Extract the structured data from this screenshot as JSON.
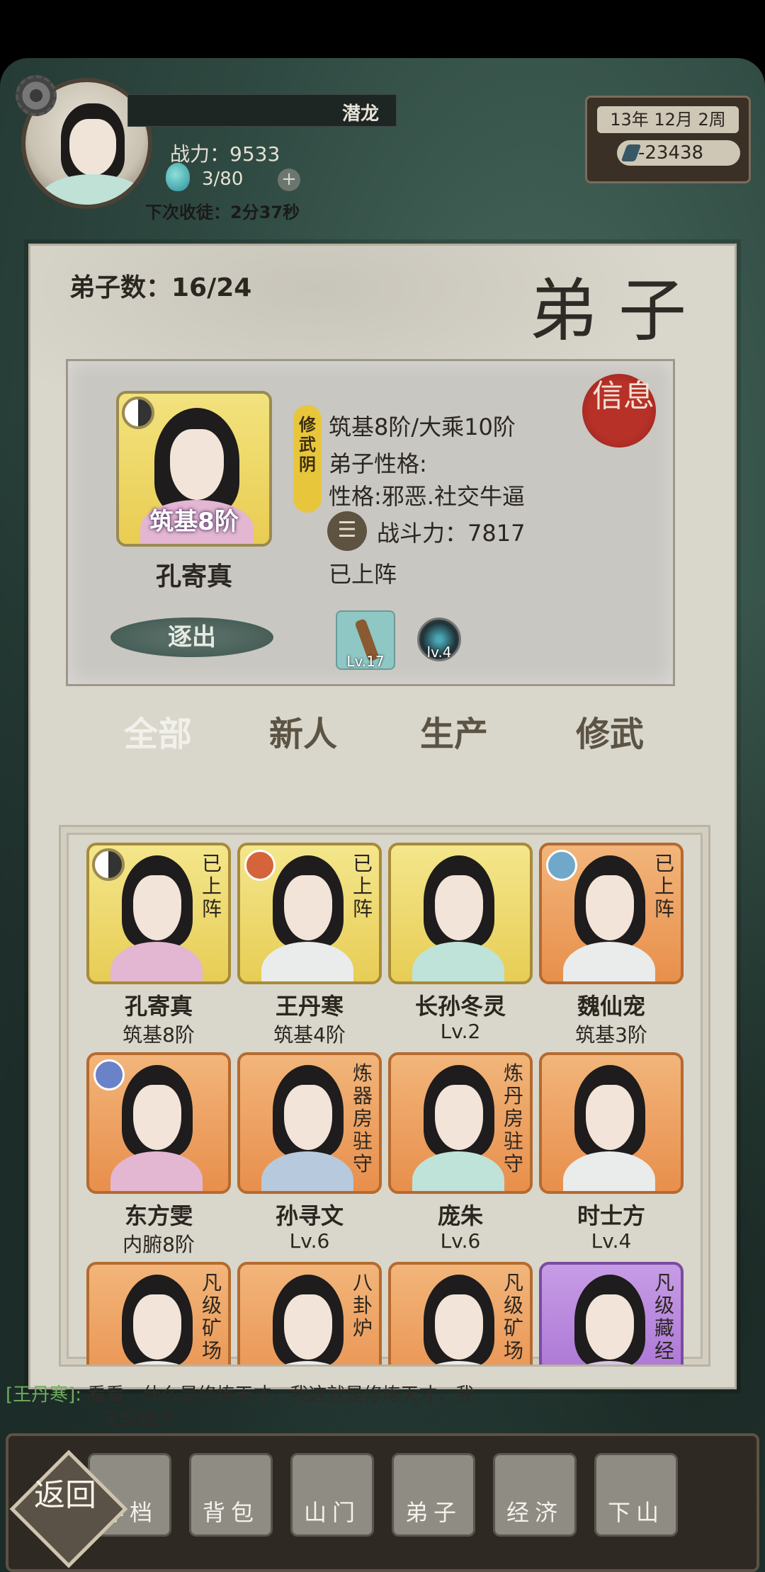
{
  "hud": {
    "rank": "潜龙",
    "power_label": "战力：9533",
    "stones": "3/80",
    "plus": "+",
    "countdown": "下次收徒：2分37秒",
    "date": "13年 12月  2周",
    "money": "-23438"
  },
  "panel": {
    "count_label": "弟子数：16/24",
    "title": "弟子"
  },
  "detail": {
    "realm_badge": "筑基8阶",
    "name": "孔寄真",
    "sect_tag": "修武阴",
    "realm_line": "筑基8阶/大乘10阶",
    "personality_label": "弟子性格:",
    "personality_value": "性格:邪恶.社交牛逼",
    "fight_icon": "☰",
    "fight_power": "战斗力：7817",
    "deploy_status": "已上阵",
    "info_seal": "信息",
    "expel_button": "逐出",
    "equip_1_level": "Lv.17",
    "equip_2_level": "lv.4"
  },
  "tabs": [
    "全部",
    "新人",
    "生产",
    "修武"
  ],
  "disciples": [
    {
      "name": "孔寄真",
      "level": "筑基8阶",
      "status": "已上阵",
      "frame": "gold",
      "robe": "pink",
      "badge": "yinyang"
    },
    {
      "name": "王丹寒",
      "level": "筑基4阶",
      "status": "已上阵",
      "frame": "gold",
      "robe": "white",
      "badge": "fire"
    },
    {
      "name": "长孙冬灵",
      "level": "Lv.2",
      "status": "",
      "frame": "gold",
      "robe": "mint",
      "badge": ""
    },
    {
      "name": "魏仙宠",
      "level": "筑基3阶",
      "status": "已上阵",
      "frame": "orange",
      "robe": "white",
      "badge": "wind"
    },
    {
      "name": "东方雯",
      "level": "内腑8阶",
      "status": "",
      "frame": "orange",
      "robe": "pink",
      "badge": "cloud"
    },
    {
      "name": "孙寻文",
      "level": "Lv.6",
      "status": "炼器房驻守",
      "frame": "orange",
      "robe": "blue",
      "badge": ""
    },
    {
      "name": "庞朱",
      "level": "Lv.6",
      "status": "炼丹房驻守",
      "frame": "orange",
      "robe": "mint",
      "badge": ""
    },
    {
      "name": "时士方",
      "level": "Lv.4",
      "status": "",
      "frame": "orange",
      "robe": "white",
      "badge": ""
    },
    {
      "name": "",
      "level": "",
      "status": "凡级矿场",
      "frame": "orange",
      "robe": "white",
      "badge": ""
    },
    {
      "name": "",
      "level": "",
      "status": "八卦炉",
      "frame": "orange",
      "robe": "white",
      "badge": ""
    },
    {
      "name": "",
      "level": "",
      "status": "凡级矿场",
      "frame": "orange",
      "robe": "white",
      "badge": ""
    },
    {
      "name": "",
      "level": "",
      "status": "凡级藏经",
      "frame": "purple",
      "robe": "lavender",
      "badge": ""
    }
  ],
  "chat": {
    "speaker": "[王丹寒]:",
    "line1": "看看，什么是修炼天才，我这就是修炼天才，我",
    "line2": "又突破了"
  },
  "nav": {
    "back": "返回",
    "items": [
      "存档",
      "背包",
      "山门",
      "弟子",
      "经济",
      "下山"
    ]
  }
}
